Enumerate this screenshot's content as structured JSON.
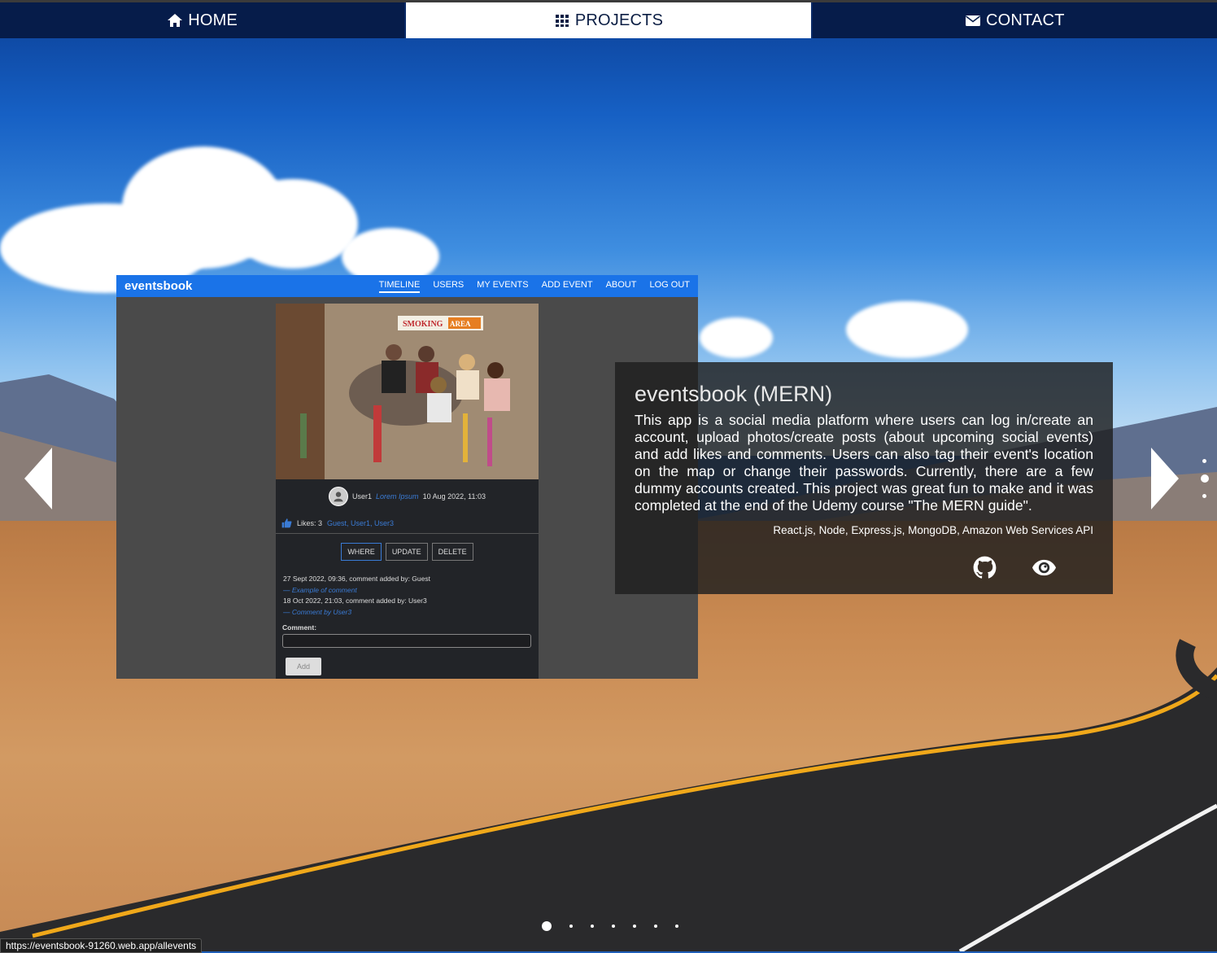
{
  "nav": {
    "home": {
      "label": "HOME",
      "icon": "home-icon"
    },
    "projects": {
      "label": "PROJECTS",
      "icon": "grid-icon"
    },
    "contact": {
      "label": "CONTACT",
      "icon": "envelope-icon"
    }
  },
  "shot": {
    "brand": "eventsbook",
    "links": [
      "TIMELINE",
      "USERS",
      "MY EVENTS",
      "ADD EVENT",
      "ABOUT",
      "LOG OUT"
    ],
    "image_sign_left": "SMOKING",
    "image_sign_right": "AREA",
    "user": "User1",
    "user_note": "Lorem Ipsum",
    "date": "10 Aug 2022, 11:03",
    "likes": "Likes: 3",
    "likers": "Guest, User1, User3",
    "buttons": [
      "WHERE",
      "UPDATE",
      "DELETE"
    ],
    "comments": [
      {
        "meta": "27 Sept 2022, 09:36, comment added by: Guest",
        "text": "— Example of comment"
      },
      {
        "meta": "18 Oct 2022, 21:03, comment added by: User3",
        "text": "— Comment by User3"
      }
    ],
    "comment_label": "Comment:",
    "add_label": "Add"
  },
  "project": {
    "title": "eventsbook (MERN)",
    "description": "This app is a social media platform where users can log in/create an account, upload photos/create posts (about upcoming social events) and add likes and comments. Users can also tag their event's location on the map or change their passwords. Currently, there are a few dummy accounts created. This project was great fun to make and it was completed at the end of the Udemy course \"The MERN guide\".",
    "tech": "React.js, Node, Express.js, MongoDB, Amazon Web Services API",
    "icons": [
      "github-icon",
      "eye-icon"
    ]
  },
  "carousel": {
    "slide_count": 7,
    "active_index": 0
  },
  "status_url": "https://eventsbook-91260.web.app/allevents",
  "colors": {
    "nav_bg": "#061c4a",
    "shot_header": "#1a73e8",
    "link_blue": "#3a7bd5"
  }
}
